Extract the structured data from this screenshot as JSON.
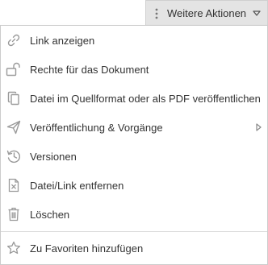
{
  "trigger": {
    "label": "Weitere Aktionen",
    "kebab_icon": "kebab-vertical-icon",
    "caret_icon": "caret-down-icon"
  },
  "menu": {
    "items": [
      {
        "label": "Link anzeigen",
        "icon": "link-icon"
      },
      {
        "label": "Rechte für das Dokument",
        "icon": "unlock-icon"
      },
      {
        "label": "Datei im Quellformat oder als PDF veröffentlichen",
        "icon": "copy-icon"
      },
      {
        "label": "Veröffentlichung & Vorgänge",
        "icon": "send-icon",
        "submenu_icon": "chevron-right-icon"
      },
      {
        "label": "Versionen",
        "icon": "history-icon"
      },
      {
        "label": "Datei/Link entfernen",
        "icon": "remove-file-icon"
      },
      {
        "label": "Löschen",
        "icon": "trash-icon"
      }
    ],
    "footer_item": {
      "label": "Zu Favoriten hinzufügen",
      "icon": "star-icon"
    }
  },
  "colors": {
    "icon_gray": "#9a9a9a",
    "text": "#333333",
    "trigger_bg": "#e4e4e4",
    "border": "#cccccc"
  }
}
